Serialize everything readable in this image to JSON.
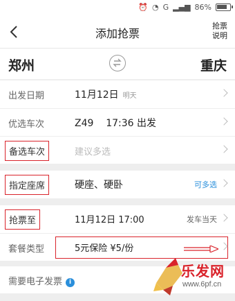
{
  "statusbar": {
    "signal_label": "G",
    "battery": "86%"
  },
  "header": {
    "title": "添加抢票",
    "help_line1": "抢票",
    "help_line2": "说明"
  },
  "route": {
    "from": "郑州",
    "to": "重庆"
  },
  "rows": {
    "date": {
      "label": "出发日期",
      "value": "11月12日",
      "sub": "明天"
    },
    "preferred_train": {
      "label": "优选车次",
      "value": "Z49    17:36 出发"
    },
    "backup_train": {
      "label": "备选车次",
      "placeholder": "建议多选"
    },
    "seat": {
      "label": "指定座席",
      "value": "硬座、硬卧",
      "right": "可多选"
    },
    "grab_until": {
      "label": "抢票至",
      "value": "11月12日 17:00",
      "right": "发车当天"
    },
    "package": {
      "label": "套餐类型",
      "value": "5元保险 ¥5/份"
    },
    "invoice": {
      "label": "需要电子发票",
      "info_icon": "i"
    }
  },
  "watermark": {
    "text": "乐发网",
    "url": "www.6pf.cn"
  },
  "colors": {
    "highlight_box": "#d9232b",
    "accent_blue": "#2a8fdb"
  }
}
